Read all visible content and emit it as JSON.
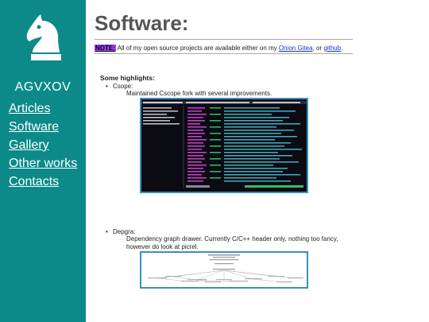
{
  "sidebar": {
    "site_name": "AGVXOV",
    "logo_icon": "chess-knight-icon",
    "nav": [
      {
        "label": "Articles"
      },
      {
        "label": "Software"
      },
      {
        "label": "Gallery"
      },
      {
        "label": "Other works"
      },
      {
        "label": "Contacts"
      }
    ],
    "colors": {
      "background": "#0c8a8a",
      "text": "#ffffff"
    }
  },
  "main": {
    "title": "Software:",
    "note": {
      "badge": "NOTE:",
      "text_before": " All of my open source projects are available either on my ",
      "link1": "Onion Gitea",
      "text_middle": ", or ",
      "link2": "github",
      "text_after": "."
    },
    "highlights_heading": "Some highlights:",
    "projects": [
      {
        "name": "Csope:",
        "description": "Maintained Cscope fork with several improvements."
      },
      {
        "name": "Depgra:",
        "description_lines": [
          "Dependency graph drawer. Currently C/C++ header only, nothing too fancy,",
          "however do look at picrel."
        ]
      }
    ]
  }
}
